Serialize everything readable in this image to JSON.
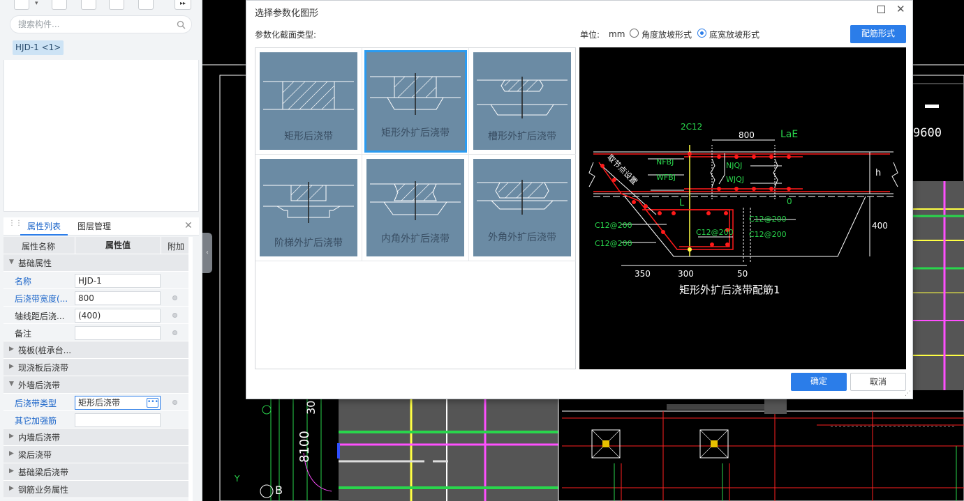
{
  "left_panel": {
    "search_placeholder": "搜索构件...",
    "component_chip": "HJD-1 <1>",
    "tabs": [
      "属性列表",
      "图层管理"
    ],
    "table_headers": [
      "属性名称",
      "属性值",
      "附加"
    ],
    "groups": {
      "basic": "基础属性",
      "raft": "筏板(桩承台...",
      "slab": "现浇板后浇带",
      "outer_wall": "外墙后浇带",
      "inner_wall": "内墙后浇带",
      "beam": "梁后浇带",
      "foundation_beam": "基础梁后浇带",
      "rebar": "钢筋业务属性"
    },
    "props": [
      {
        "name": "名称",
        "value": "HJD-1"
      },
      {
        "name": "后浇带宽度(...",
        "value": "800"
      },
      {
        "name": "轴线距后浇...",
        "value": "(400)"
      },
      {
        "name": "备注",
        "value": ""
      }
    ],
    "outer_props": [
      {
        "name": "后浇带类型",
        "value": "矩形后浇带"
      },
      {
        "name": "其它加强筋",
        "value": ""
      }
    ]
  },
  "dialog": {
    "title": "选择参数化图形",
    "section_label": "参数化截面类型:",
    "unit_label": "单位:",
    "unit_value": "mm",
    "radio_angle": "角度放坡形式",
    "radio_width": "底宽放坡形式",
    "rebar_button": "配筋形式",
    "ok": "确定",
    "cancel": "取消",
    "shapes": [
      "矩形后浇带",
      "矩形外扩后浇带",
      "槽形外扩后浇带",
      "阶梯外扩后浇带",
      "内角外扩后浇带",
      "外角外扩后浇带"
    ],
    "selected_shape": "矩形外扩后浇带"
  },
  "preview": {
    "caption": "矩形外扩后浇带配筋1",
    "labels": {
      "top_bar": "2C12",
      "width": "800",
      "lae": "LaE",
      "nfbj": "NFBJ",
      "wfbj": "WFBJ",
      "njqj": "NJQJ",
      "wjqj": "WJQJ",
      "h": "h",
      "l": "L",
      "zero": "0",
      "slope_note": "取节点设置",
      "c12_left_1": "C12@200",
      "c12_left_2": "C12@200",
      "c12_mid": "C12@200",
      "c12_right_1": "C12@200",
      "c12_right_2": "C12@200",
      "depth": "400",
      "dim_350": "350",
      "dim_300": "300",
      "dim_50": "50"
    }
  },
  "cad": {
    "num_9600": "9600",
    "num_8100": "8100",
    "num_30": "30",
    "axis_b": "B",
    "axis_y": "Y"
  },
  "colors": {
    "accent": "#2b7de9",
    "thumb": "#6b8ba4",
    "cad_green": "#29d64c",
    "cad_red": "#ff1a1a"
  }
}
